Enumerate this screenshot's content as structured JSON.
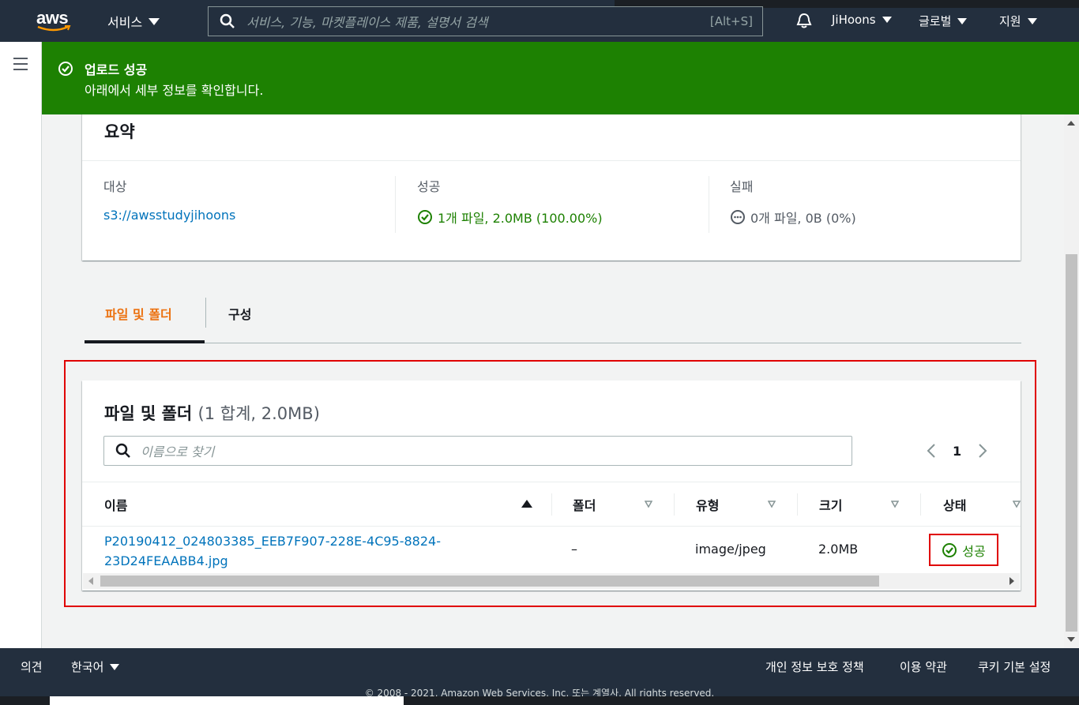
{
  "topnav": {
    "logo": "aws",
    "services_label": "서비스",
    "search_placeholder": "서비스, 기능, 마켓플레이스 제품, 설명서 검색",
    "search_shortcut": "[Alt+S]",
    "user_label": "JiHoons",
    "region_label": "글로벌",
    "support_label": "지원"
  },
  "flash": {
    "title": "업로드 성공",
    "message": "아래에서 세부 정보를 확인합니다."
  },
  "summary": {
    "heading": "요약",
    "target_label": "대상",
    "target_value": "s3://awsstudyjihoons",
    "success_label": "성공",
    "success_value": "1개 파일, 2.0MB (100.00%)",
    "failed_label": "실패",
    "failed_value": "0개 파일, 0B (0%)"
  },
  "tabs": [
    {
      "label": "파일 및 폴더",
      "active": true
    },
    {
      "label": "구성",
      "active": false
    }
  ],
  "files": {
    "heading": "파일 및 폴더",
    "count": "(1 합계, 2.0MB)",
    "filter_placeholder": "이름으로 찾기",
    "page": "1",
    "columns": [
      "이름",
      "폴더",
      "유형",
      "크기",
      "상태"
    ],
    "rows": [
      {
        "name_line1": "P20190412_024803385_EEB7F907-228E-4C95-8824-",
        "name_line2": "23D24FEAABB4.jpg",
        "folder": "–",
        "type": "image/jpeg",
        "size": "2.0MB",
        "status": "성공"
      }
    ]
  },
  "footer": {
    "feedback": "의견",
    "language": "한국어",
    "privacy": "개인 정보 보호 정책",
    "terms": "이용 약관",
    "cookies": "쿠키 기본 설정",
    "copyright": "© 2008 - 2021, Amazon Web Services, Inc. 또는 계열사. All rights reserved."
  },
  "colors": {
    "nav_bg": "#232f3e",
    "success_green": "#1d8102",
    "link_blue": "#0073bb",
    "active_tab_orange": "#ec7211",
    "highlight_red": "#e00000"
  }
}
